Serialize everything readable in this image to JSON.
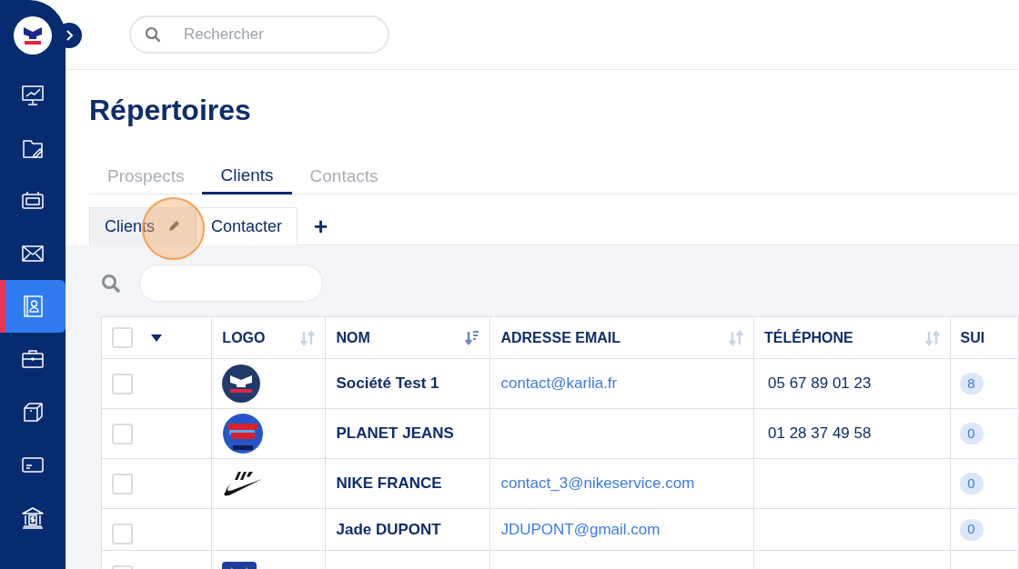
{
  "sidebar": {
    "items": [
      {
        "kind": "chart",
        "selected": false
      },
      {
        "kind": "folder",
        "selected": false
      },
      {
        "kind": "calendar",
        "selected": false
      },
      {
        "kind": "mail",
        "selected": false
      },
      {
        "kind": "contacts",
        "selected": true
      },
      {
        "kind": "briefcase",
        "selected": false
      },
      {
        "kind": "box",
        "selected": false
      },
      {
        "kind": "card",
        "selected": false
      },
      {
        "kind": "bank",
        "selected": false
      }
    ]
  },
  "search": {
    "placeholder": "Rechercher"
  },
  "page_title": "Répertoires",
  "tabs": [
    {
      "label": "Prospects",
      "selected": false
    },
    {
      "label": "Clients",
      "selected": true
    },
    {
      "label": "Contacts",
      "selected": false
    }
  ],
  "views": [
    {
      "label": "Clients",
      "selected": true,
      "editable": true
    },
    {
      "label": "Contacter",
      "selected": false,
      "editable": false
    }
  ],
  "add_view": "+",
  "table": {
    "select_all_checked": false,
    "columns": [
      {
        "label": "LOGO",
        "kind": "sortable"
      },
      {
        "label": "NOM",
        "kind": "sorted"
      },
      {
        "label": "ADRESSE EMAIL",
        "kind": "sortable"
      },
      {
        "label": "TÉLÉPHONE",
        "kind": "sortable"
      },
      {
        "label": "SUI",
        "kind": "plain"
      }
    ],
    "rows": [
      {
        "checked": false,
        "kind": "round",
        "name": "Société Test 1",
        "email": "contact@karlia.fr",
        "phone": "05 67 89 01 23",
        "count": "8"
      },
      {
        "checked": false,
        "kind": "globe",
        "name": "PLANET JEANS",
        "phone": "01 28 37 49 58",
        "count": "0"
      },
      {
        "checked": false,
        "kind": "swoosh",
        "name": "NIKE FRANCE",
        "email": "contact_3@nikeservice.com",
        "count": "0"
      },
      {
        "checked": false,
        "kind": "none",
        "name": "Jade DUPONT",
        "email": "JDUPONT@gmail.com",
        "count": "0"
      },
      {
        "checked": false,
        "kind": "square"
      }
    ]
  }
}
